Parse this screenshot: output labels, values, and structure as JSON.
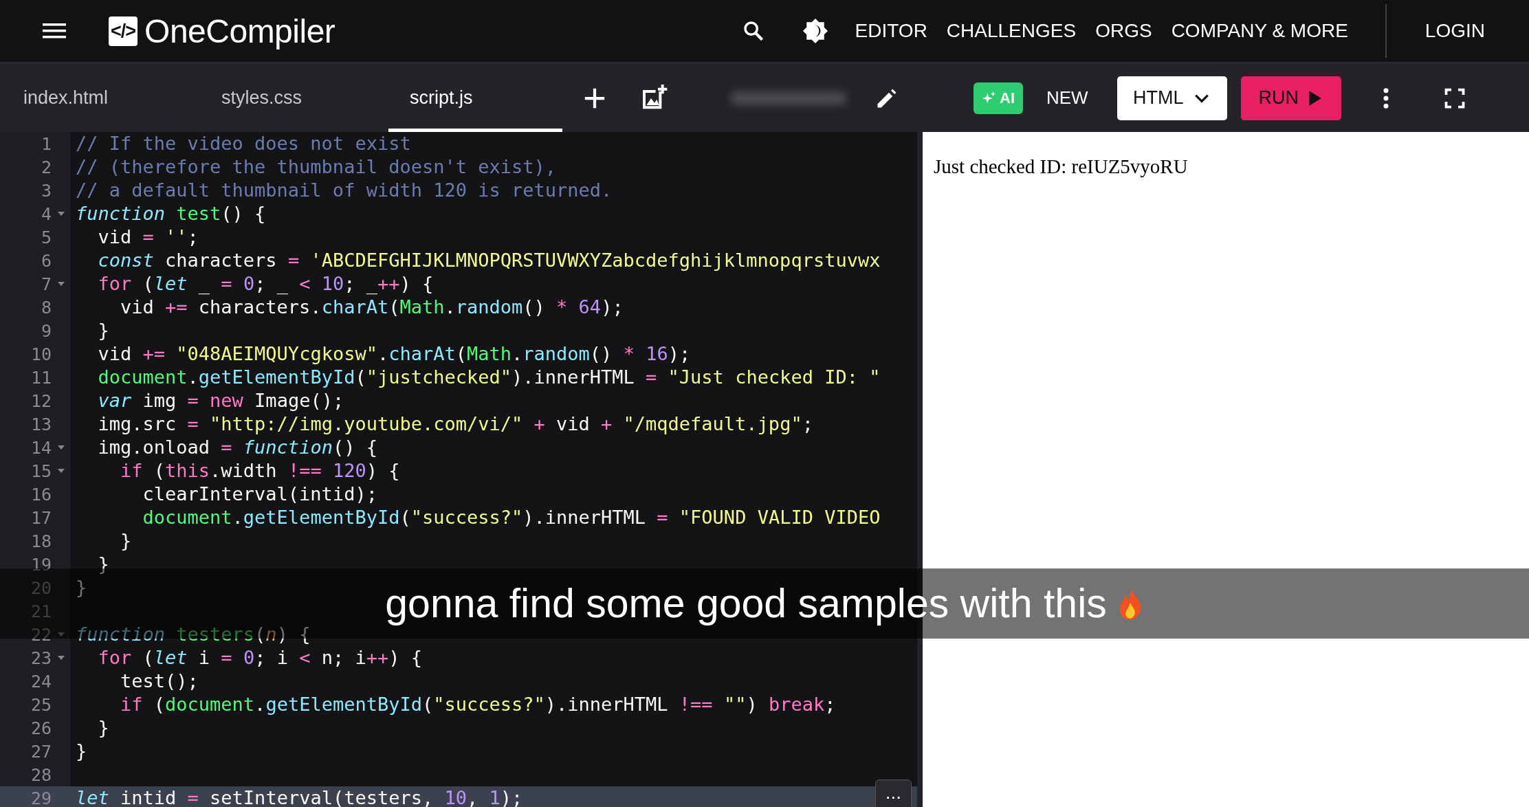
{
  "header": {
    "logo_mark": "</>",
    "logo_text": "OneCompiler",
    "nav": [
      "EDITOR",
      "CHALLENGES",
      "ORGS",
      "COMPANY & MORE"
    ],
    "login": "LOGIN"
  },
  "toolbar": {
    "files": [
      {
        "label": "index.html",
        "selected": false
      },
      {
        "label": "styles.css",
        "selected": false
      },
      {
        "label": "script.js",
        "selected": true
      }
    ],
    "ai": "AI",
    "new": "NEW",
    "language": "HTML",
    "run": "RUN"
  },
  "editor": {
    "lines": [
      {
        "number": "1",
        "fold": false,
        "active": false,
        "tokens": [
          {
            "text": "// If the video does not exist",
            "kind": "comment"
          }
        ]
      },
      {
        "number": "2",
        "fold": false,
        "active": false,
        "tokens": [
          {
            "text": "// (therefore the thumbnail doesn't exist),",
            "kind": "comment"
          }
        ]
      },
      {
        "number": "3",
        "fold": false,
        "active": false,
        "tokens": [
          {
            "text": "// a default thumbnail of width 120 is returned.",
            "kind": "comment"
          }
        ]
      },
      {
        "number": "4",
        "fold": true,
        "active": false,
        "tokens": [
          {
            "text": "function",
            "kind": "storage"
          },
          {
            "text": " test",
            "kind": "entity"
          },
          {
            "text": "() {",
            "kind": "plain"
          }
        ]
      },
      {
        "number": "5",
        "fold": false,
        "active": false,
        "tokens": [
          {
            "text": "  vid ",
            "kind": "plain"
          },
          {
            "text": "=",
            "kind": "keyword"
          },
          {
            "text": " ''",
            "kind": "string"
          },
          {
            "text": ";",
            "kind": "plain"
          }
        ]
      },
      {
        "number": "6",
        "fold": false,
        "active": false,
        "tokens": [
          {
            "text": "  const",
            "kind": "storage"
          },
          {
            "text": " characters ",
            "kind": "plain"
          },
          {
            "text": "=",
            "kind": "keyword"
          },
          {
            "text": " 'ABCDEFGHIJKLMNOPQRSTUVWXYZabcdefghijklmnopqrstuvwx",
            "kind": "string"
          }
        ]
      },
      {
        "number": "7",
        "fold": true,
        "active": false,
        "tokens": [
          {
            "text": "  for",
            "kind": "keyword"
          },
          {
            "text": " (",
            "kind": "plain"
          },
          {
            "text": "let",
            "kind": "storage"
          },
          {
            "text": " _ ",
            "kind": "plain"
          },
          {
            "text": "=",
            "kind": "keyword"
          },
          {
            "text": " 0",
            "kind": "number"
          },
          {
            "text": "; _ ",
            "kind": "plain"
          },
          {
            "text": "<",
            "kind": "keyword"
          },
          {
            "text": " 10",
            "kind": "number"
          },
          {
            "text": "; _",
            "kind": "plain"
          },
          {
            "text": "++",
            "kind": "keyword"
          },
          {
            "text": ") {",
            "kind": "plain"
          }
        ]
      },
      {
        "number": "8",
        "fold": false,
        "active": false,
        "tokens": [
          {
            "text": "    vid ",
            "kind": "plain"
          },
          {
            "text": "+=",
            "kind": "keyword"
          },
          {
            "text": " characters.",
            "kind": "plain"
          },
          {
            "text": "charAt",
            "kind": "method"
          },
          {
            "text": "(",
            "kind": "plain"
          },
          {
            "text": "Math",
            "kind": "entity"
          },
          {
            "text": ".",
            "kind": "plain"
          },
          {
            "text": "random",
            "kind": "method"
          },
          {
            "text": "() ",
            "kind": "plain"
          },
          {
            "text": "*",
            "kind": "keyword"
          },
          {
            "text": " 64",
            "kind": "number"
          },
          {
            "text": ");",
            "kind": "plain"
          }
        ]
      },
      {
        "number": "9",
        "fold": false,
        "active": false,
        "tokens": [
          {
            "text": "  }",
            "kind": "plain"
          }
        ]
      },
      {
        "number": "10",
        "fold": false,
        "active": false,
        "tokens": [
          {
            "text": "  vid ",
            "kind": "plain"
          },
          {
            "text": "+=",
            "kind": "keyword"
          },
          {
            "text": " \"048AEIMQUYcgkosw\"",
            "kind": "string"
          },
          {
            "text": ".",
            "kind": "plain"
          },
          {
            "text": "charAt",
            "kind": "method"
          },
          {
            "text": "(",
            "kind": "plain"
          },
          {
            "text": "Math",
            "kind": "entity"
          },
          {
            "text": ".",
            "kind": "plain"
          },
          {
            "text": "random",
            "kind": "method"
          },
          {
            "text": "() ",
            "kind": "plain"
          },
          {
            "text": "*",
            "kind": "keyword"
          },
          {
            "text": " 16",
            "kind": "number"
          },
          {
            "text": ");",
            "kind": "plain"
          }
        ]
      },
      {
        "number": "11",
        "fold": false,
        "active": false,
        "tokens": [
          {
            "text": "  document",
            "kind": "entity"
          },
          {
            "text": ".",
            "kind": "plain"
          },
          {
            "text": "getElementById",
            "kind": "method"
          },
          {
            "text": "(",
            "kind": "plain"
          },
          {
            "text": "\"justchecked\"",
            "kind": "string"
          },
          {
            "text": ").innerHTML ",
            "kind": "plain"
          },
          {
            "text": "=",
            "kind": "keyword"
          },
          {
            "text": " \"Just checked ID: \"",
            "kind": "string"
          }
        ]
      },
      {
        "number": "12",
        "fold": false,
        "active": false,
        "tokens": [
          {
            "text": "  var",
            "kind": "storage"
          },
          {
            "text": " img ",
            "kind": "plain"
          },
          {
            "text": "=",
            "kind": "keyword"
          },
          {
            "text": " new",
            "kind": "keyword"
          },
          {
            "text": " Image();",
            "kind": "plain"
          }
        ]
      },
      {
        "number": "13",
        "fold": false,
        "active": false,
        "tokens": [
          {
            "text": "  img.src ",
            "kind": "plain"
          },
          {
            "text": "=",
            "kind": "keyword"
          },
          {
            "text": " \"http://img.youtube.com/vi/\"",
            "kind": "string"
          },
          {
            "text": " +",
            "kind": "keyword"
          },
          {
            "text": " vid ",
            "kind": "plain"
          },
          {
            "text": "+",
            "kind": "keyword"
          },
          {
            "text": " \"/mqdefault.jpg\"",
            "kind": "string"
          },
          {
            "text": ";",
            "kind": "plain"
          }
        ]
      },
      {
        "number": "14",
        "fold": true,
        "active": false,
        "tokens": [
          {
            "text": "  img.onload ",
            "kind": "plain"
          },
          {
            "text": "=",
            "kind": "keyword"
          },
          {
            "text": " function",
            "kind": "storage"
          },
          {
            "text": "() {",
            "kind": "plain"
          }
        ]
      },
      {
        "number": "15",
        "fold": true,
        "active": false,
        "tokens": [
          {
            "text": "    if",
            "kind": "keyword"
          },
          {
            "text": " (",
            "kind": "plain"
          },
          {
            "text": "this",
            "kind": "keyword"
          },
          {
            "text": ".width ",
            "kind": "plain"
          },
          {
            "text": "!==",
            "kind": "keyword"
          },
          {
            "text": " 120",
            "kind": "number"
          },
          {
            "text": ") {",
            "kind": "plain"
          }
        ]
      },
      {
        "number": "16",
        "fold": false,
        "active": false,
        "tokens": [
          {
            "text": "      clearInterval(intid);",
            "kind": "plain"
          }
        ]
      },
      {
        "number": "17",
        "fold": false,
        "active": false,
        "tokens": [
          {
            "text": "      document",
            "kind": "entity"
          },
          {
            "text": ".",
            "kind": "plain"
          },
          {
            "text": "getElementById",
            "kind": "method"
          },
          {
            "text": "(",
            "kind": "plain"
          },
          {
            "text": "\"success?\"",
            "kind": "string"
          },
          {
            "text": ").innerHTML ",
            "kind": "plain"
          },
          {
            "text": "=",
            "kind": "keyword"
          },
          {
            "text": " \"FOUND VALID VIDEO",
            "kind": "string"
          }
        ]
      },
      {
        "number": "18",
        "fold": false,
        "active": false,
        "tokens": [
          {
            "text": "    }",
            "kind": "plain"
          }
        ]
      },
      {
        "number": "19",
        "fold": false,
        "active": false,
        "tokens": [
          {
            "text": "  }",
            "kind": "plain"
          }
        ]
      },
      {
        "number": "20",
        "fold": false,
        "active": false,
        "tokens": [
          {
            "text": "}",
            "kind": "plain"
          }
        ]
      },
      {
        "number": "21",
        "fold": false,
        "active": false
      },
      {
        "number": "22",
        "fold": true,
        "active": false,
        "tokens": [
          {
            "text": "function",
            "kind": "storage"
          },
          {
            "text": " testers",
            "kind": "entity"
          },
          {
            "text": "(",
            "kind": "plain"
          },
          {
            "text": "n",
            "kind": "param"
          },
          {
            "text": ") {",
            "kind": "plain"
          }
        ]
      },
      {
        "number": "23",
        "fold": true,
        "active": false,
        "tokens": [
          {
            "text": "  for",
            "kind": "keyword"
          },
          {
            "text": " (",
            "kind": "plain"
          },
          {
            "text": "let",
            "kind": "storage"
          },
          {
            "text": " i ",
            "kind": "plain"
          },
          {
            "text": "=",
            "kind": "keyword"
          },
          {
            "text": " 0",
            "kind": "number"
          },
          {
            "text": "; i ",
            "kind": "plain"
          },
          {
            "text": "<",
            "kind": "keyword"
          },
          {
            "text": " n; i",
            "kind": "plain"
          },
          {
            "text": "++",
            "kind": "keyword"
          },
          {
            "text": ") {",
            "kind": "plain"
          }
        ]
      },
      {
        "number": "24",
        "fold": false,
        "active": false,
        "tokens": [
          {
            "text": "    test();",
            "kind": "plain"
          }
        ]
      },
      {
        "number": "25",
        "fold": false,
        "active": false,
        "tokens": [
          {
            "text": "    if",
            "kind": "keyword"
          },
          {
            "text": " (",
            "kind": "plain"
          },
          {
            "text": "document",
            "kind": "entity"
          },
          {
            "text": ".",
            "kind": "plain"
          },
          {
            "text": "getElementById",
            "kind": "method"
          },
          {
            "text": "(",
            "kind": "plain"
          },
          {
            "text": "\"success?\"",
            "kind": "string"
          },
          {
            "text": ").innerHTML ",
            "kind": "plain"
          },
          {
            "text": "!==",
            "kind": "keyword"
          },
          {
            "text": " \"\"",
            "kind": "string"
          },
          {
            "text": ") ",
            "kind": "plain"
          },
          {
            "text": "break",
            "kind": "keyword"
          },
          {
            "text": ";",
            "kind": "plain"
          }
        ]
      },
      {
        "number": "26",
        "fold": false,
        "active": false,
        "tokens": [
          {
            "text": "  }",
            "kind": "plain"
          }
        ]
      },
      {
        "number": "27",
        "fold": false,
        "active": false,
        "tokens": [
          {
            "text": "}",
            "kind": "plain"
          }
        ]
      },
      {
        "number": "28",
        "fold": false,
        "active": false
      },
      {
        "number": "29",
        "fold": false,
        "active": true,
        "tokens": [
          {
            "text": "let",
            "kind": "storage"
          },
          {
            "text": " intid ",
            "kind": "plain"
          },
          {
            "text": "=",
            "kind": "keyword"
          },
          {
            "text": " setInterval(testers, ",
            "kind": "plain"
          },
          {
            "text": "10",
            "kind": "number"
          },
          {
            "text": ", ",
            "kind": "plain"
          },
          {
            "text": "1",
            "kind": "number"
          },
          {
            "text": ");",
            "kind": "plain"
          }
        ]
      }
    ],
    "more_button": "..."
  },
  "output": {
    "text": "Just checked ID: reIUZ5vyoRU"
  },
  "caption": {
    "text": "gonna find some good samples with this"
  }
}
